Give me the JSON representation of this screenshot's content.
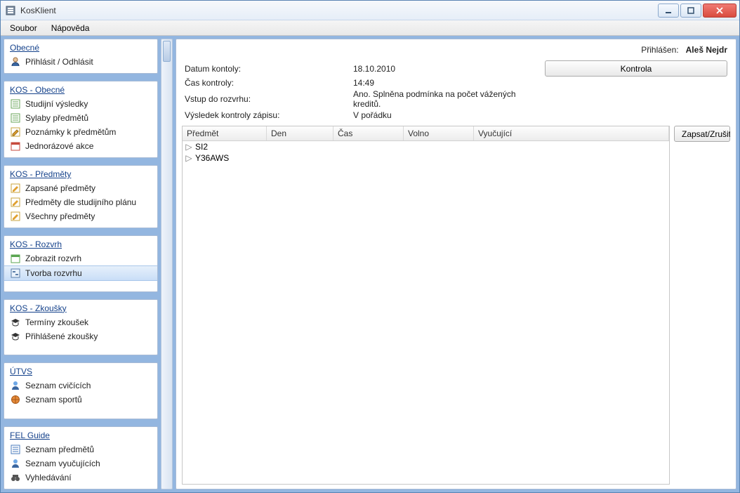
{
  "window": {
    "title": "KosKlient"
  },
  "menu": {
    "file": "Soubor",
    "help": "Nápověda"
  },
  "sidebar": {
    "groups": [
      {
        "title": "Obecné",
        "items": [
          {
            "icon": "person",
            "label": "Přihlásit / Odhlásit"
          }
        ]
      },
      {
        "title": "KOS - Obecné",
        "items": [
          {
            "icon": "list-green",
            "label": "Studijní výsledky"
          },
          {
            "icon": "list-green",
            "label": "Sylaby předmětů"
          },
          {
            "icon": "note-edit",
            "label": "Poznámky k předmětům"
          },
          {
            "icon": "calendar-red",
            "label": "Jednorázové akce"
          }
        ]
      },
      {
        "title": "KOS - Předměty",
        "items": [
          {
            "icon": "note-edit",
            "label": "Zapsané předměty"
          },
          {
            "icon": "note-edit",
            "label": "Předměty dle studijního plánu"
          },
          {
            "icon": "note-edit",
            "label": "Všechny předměty"
          }
        ]
      },
      {
        "title": "KOS - Rozvrh",
        "items": [
          {
            "icon": "calendar-green",
            "label": "Zobrazit rozvrh"
          },
          {
            "icon": "schedule-blue",
            "label": "Tvorba rozvrhu",
            "selected": true
          }
        ]
      },
      {
        "title": "KOS - Zkoušky",
        "items": [
          {
            "icon": "grad-cap",
            "label": "Termíny zkoušek"
          },
          {
            "icon": "grad-cap",
            "label": "Přihlášené zkoušky"
          }
        ]
      },
      {
        "title": "ÚTVS",
        "items": [
          {
            "icon": "person-blue",
            "label": "Seznam cvičících"
          },
          {
            "icon": "ball",
            "label": "Seznam sportů"
          }
        ]
      },
      {
        "title": "FEL Guide",
        "items": [
          {
            "icon": "list-blue",
            "label": "Seznam předmětů"
          },
          {
            "icon": "person-blue",
            "label": "Seznam vyučujících"
          },
          {
            "icon": "binoculars",
            "label": "Vyhledávání"
          }
        ]
      }
    ]
  },
  "main": {
    "loginLabel": "Přihlášen:",
    "loginUser": "Aleš Nejdr",
    "rows": [
      {
        "label": "Datum kontoly:",
        "value": "18.10.2010"
      },
      {
        "label": "Čas kontroly:",
        "value": "14:49"
      },
      {
        "label": "Vstup do rozvrhu:",
        "value": "Ano. Splněna podmínka na počet vážených kreditů."
      },
      {
        "label": "Výsledek kontroly zápisu:",
        "value": "V pořádku"
      }
    ],
    "buttons": {
      "kontrola": "Kontrola",
      "zapsat": "Zapsat/Zrušit"
    },
    "columns": {
      "predmet": "Předmět",
      "den": "Den",
      "cas": "Čas",
      "volno": "Volno",
      "vyucujici": "Vyučující"
    },
    "items": [
      {
        "predmet": "SI2"
      },
      {
        "predmet": "Y36AWS"
      }
    ]
  }
}
